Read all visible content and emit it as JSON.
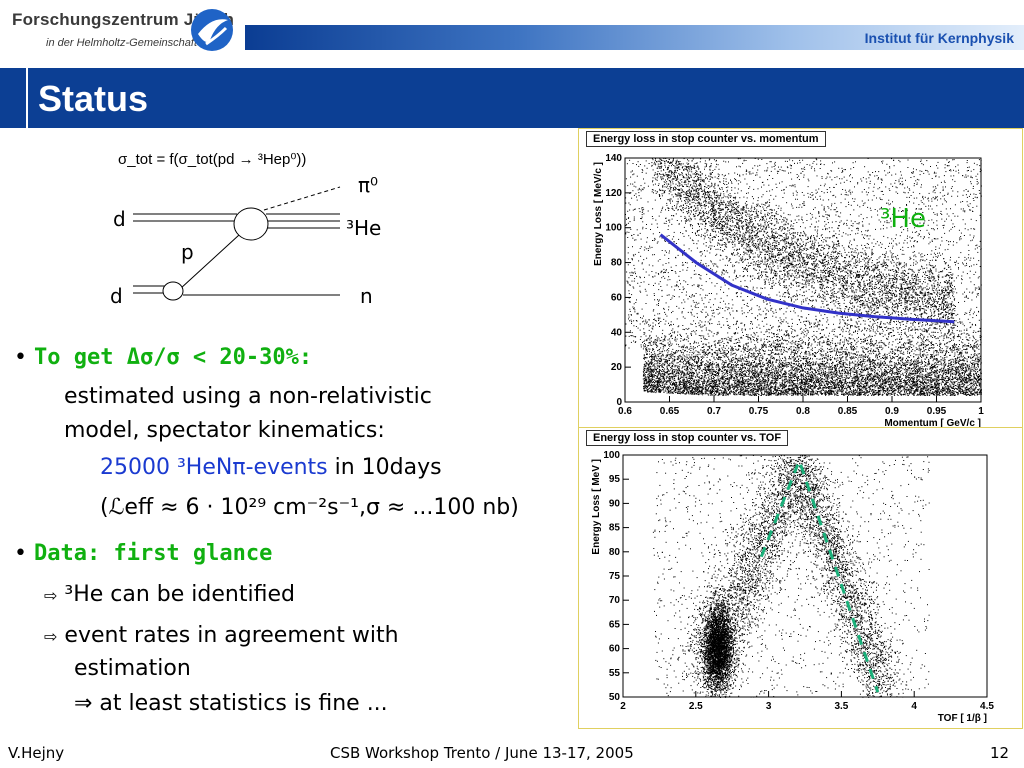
{
  "header": {
    "org_name": "Forschungszentrum Jülich",
    "org_subtitle": "in der Helmholtz-Gemeinschaft",
    "institute": "Institut für Kernphysik",
    "logo_icon": "fz-juelich-logo-icon"
  },
  "slide": {
    "title": "Status",
    "formula": "σ_tot = f(σ_tot(pd → ³Hep⁰))",
    "diagram": {
      "d_top": "d",
      "d_bottom": "d",
      "p": "p",
      "pi0": "π⁰",
      "he3": "³He",
      "n": "n"
    },
    "bullets": [
      {
        "text": "To get Δσ/σ < 20-30%:"
      },
      {
        "text": "Data: first glance"
      }
    ],
    "line_estimated_1": "estimated using a non-relativistic",
    "line_estimated_2": "model, spectator kinematics:",
    "line_events_blue": "25000 ³HeNπ-events",
    "line_events_rest": " in 10days",
    "line_lumi": "(ℒeff ≈ 6 · 10²⁹ cm⁻²s⁻¹,σ ≈ ...100 nb)",
    "sub_he": "³He can be identified",
    "sub_rates_1": "event rates in agreement with",
    "sub_rates_2": "estimation",
    "sub_stat": "⇒ at least statistics is fine ..."
  },
  "plots": {
    "he_label": "³He",
    "colors": {
      "curve": "#3232c8",
      "band": "#1ab07a",
      "label": "#10b010"
    }
  },
  "chart_data": [
    {
      "type": "scatter",
      "title": "Energy loss in stop counter vs. momentum",
      "xlabel": "Momentum  [ GeV/c ]",
      "ylabel": "Energy Loss  [ MeV/c ]",
      "xlim": [
        0.6,
        1.0
      ],
      "ylim": [
        0,
        140
      ],
      "xticks": [
        "0.6",
        "0.65",
        "0.7",
        "0.75",
        "0.8",
        "0.85",
        "0.9",
        "0.95",
        "1"
      ],
      "yticks": [
        "0",
        "20",
        "40",
        "60",
        "80",
        "100",
        "120",
        "140"
      ],
      "curve": {
        "x": [
          0.64,
          0.68,
          0.72,
          0.76,
          0.8,
          0.84,
          0.88,
          0.92,
          0.97
        ],
        "y": [
          96,
          80,
          67,
          59,
          54,
          51,
          49,
          47.5,
          46
        ]
      }
    },
    {
      "type": "scatter",
      "title": "Energy loss in stop counter vs. TOF",
      "xlabel": "TOF  [ 1/β ]",
      "ylabel": "Energy Loss  [ MeV ]",
      "xlim": [
        2,
        4.5
      ],
      "ylim": [
        50,
        100
      ],
      "xticks": [
        "2",
        "2.5",
        "3",
        "3.5",
        "4",
        "4.5"
      ],
      "yticks": [
        "50",
        "55",
        "60",
        "65",
        "70",
        "75",
        "80",
        "85",
        "90",
        "95",
        "100"
      ],
      "band_left": {
        "x": [
          2.95,
          3.2
        ],
        "y": [
          79,
          98
        ]
      },
      "band_right": {
        "x": [
          3.22,
          3.75
        ],
        "y": [
          98,
          51
        ]
      }
    }
  ],
  "footer": {
    "author": "V.Hejny",
    "event": "CSB Workshop Trento / June 13-17, 2005",
    "page": "12"
  }
}
